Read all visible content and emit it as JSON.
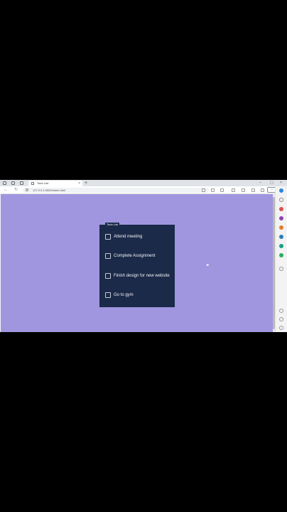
{
  "browser": {
    "tab": {
      "title": "Todo List",
      "close_glyph": "×"
    },
    "new_tab_glyph": "+",
    "window_controls": [
      "–",
      "▢",
      "×"
    ],
    "address": {
      "url": "127.0.0.1:5500/index.html"
    },
    "more_glyph": "···",
    "nav": {
      "back": "←",
      "refresh": "↻"
    }
  },
  "todo": {
    "heading": "Todo List",
    "items": [
      {
        "label": "Attend meeting",
        "checked": false
      },
      {
        "label": "Complete Assignment",
        "checked": false
      },
      {
        "label": "Finish design for new website",
        "checked": false
      },
      {
        "label": "Go to gym",
        "checked": false
      }
    ]
  },
  "colors": {
    "page_background": "#a096e0",
    "card_background": "#1b2a48",
    "outer_background": "#000000"
  }
}
